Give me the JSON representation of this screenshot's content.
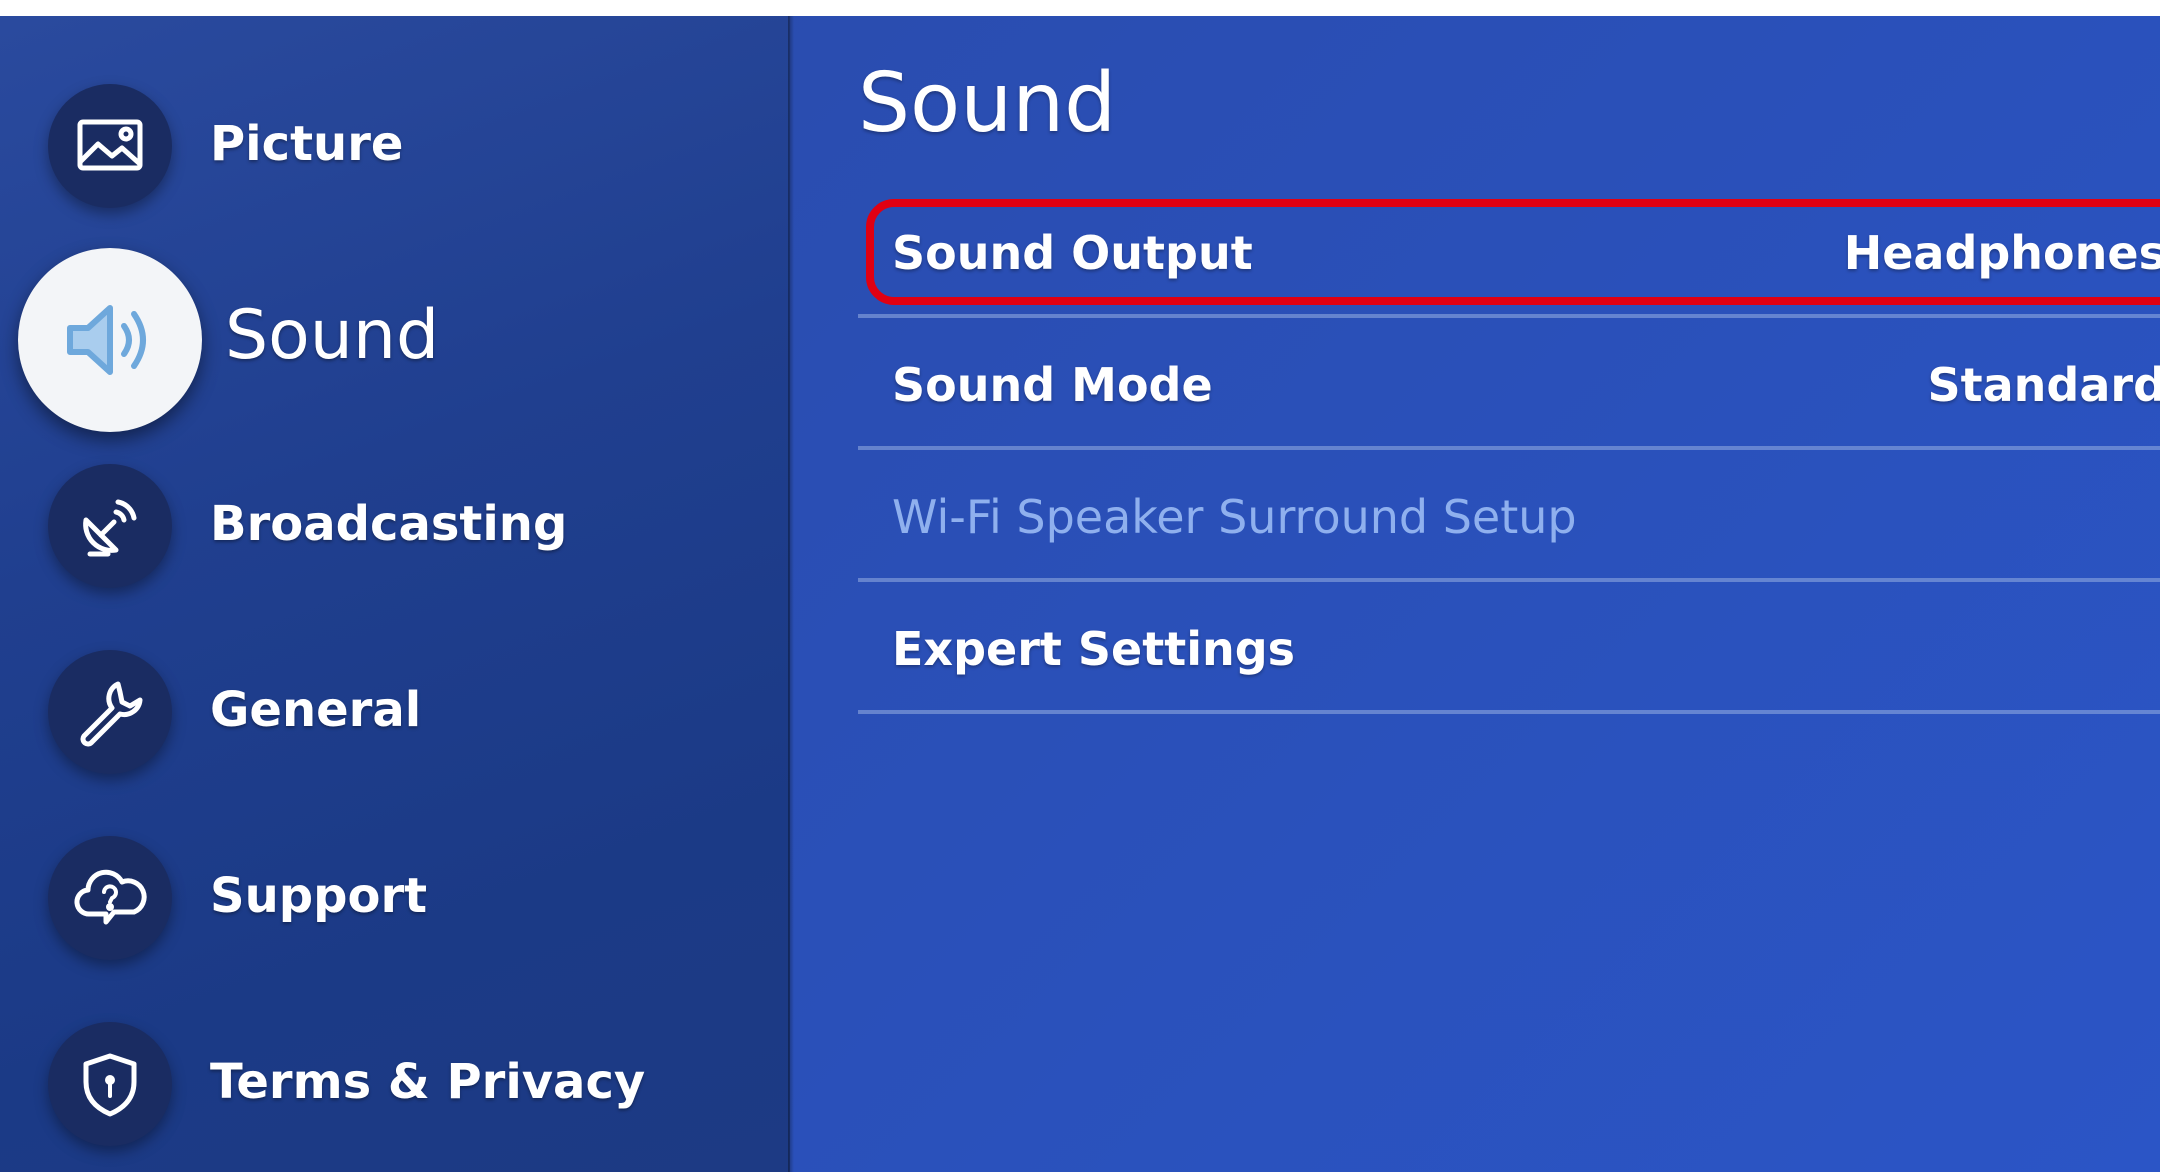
{
  "sidebar": {
    "items": [
      {
        "label": "Picture",
        "icon": "picture-icon"
      },
      {
        "label": "Sound",
        "icon": "speaker-icon",
        "active": true
      },
      {
        "label": "Broadcasting",
        "icon": "satellite-dish-icon"
      },
      {
        "label": "General",
        "icon": "wrench-icon"
      },
      {
        "label": "Support",
        "icon": "cloud-question-icon"
      },
      {
        "label": "Terms & Privacy",
        "icon": "shield-lock-icon"
      }
    ]
  },
  "main": {
    "title": "Sound",
    "rows": [
      {
        "label": "Sound Output",
        "value": "Headphones",
        "highlighted": true
      },
      {
        "label": "Sound Mode",
        "value": "Standard"
      },
      {
        "label": "Wi-Fi Speaker Surround Setup",
        "disabled": true
      },
      {
        "label": "Expert Settings"
      }
    ]
  },
  "colors": {
    "background": "#2a4fb6",
    "sidebar": "#203f8f",
    "highlight_border": "#e00012",
    "disabled_text": "#8fb0ee"
  }
}
